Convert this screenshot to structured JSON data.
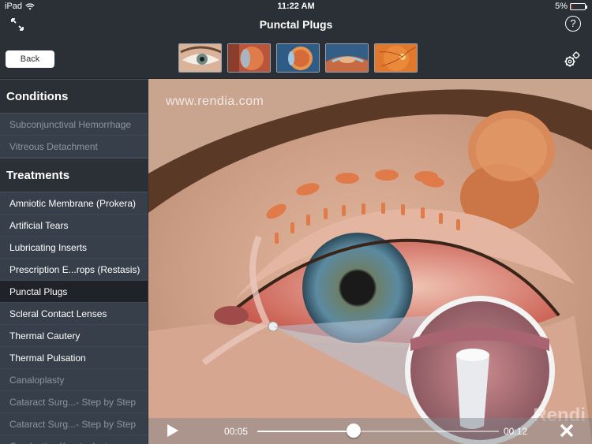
{
  "status": {
    "device": "iPad",
    "time": "11:22 AM",
    "battery": "5%",
    "battery_level": 0.05
  },
  "header": {
    "title": "Punctal Plugs"
  },
  "toolbar": {
    "back_label": "Back",
    "thumbnails": [
      "eye-front",
      "eye-cross-section-1",
      "eye-cross-section-2",
      "eye-cross-section-3",
      "retina"
    ]
  },
  "sidebar": {
    "conditions_header": "Conditions",
    "conditions": [
      {
        "label": "Subconjunctival Hemorrhage",
        "dim": true
      },
      {
        "label": "Vitreous Detachment",
        "dim": true
      }
    ],
    "treatments_header": "Treatments",
    "treatments": [
      {
        "label": "Amniotic Membrane (Prokera)"
      },
      {
        "label": "Artificial Tears"
      },
      {
        "label": "Lubricating Inserts"
      },
      {
        "label": "Prescription E...rops (Restasis)"
      },
      {
        "label": "Punctal Plugs",
        "active": true
      },
      {
        "label": "Scleral Contact Lenses"
      },
      {
        "label": "Thermal Cautery"
      },
      {
        "label": "Thermal Pulsation"
      },
      {
        "label": "Canaloplasty",
        "dim": true
      },
      {
        "label": "Cataract Surg...- Step by Step",
        "dim": true
      },
      {
        "label": "Cataract Surg...- Step by Step",
        "dim": true
      },
      {
        "label": "Conductive Keratoplasty",
        "dim": true
      }
    ]
  },
  "video": {
    "watermark": "www.rendia.com",
    "watermark_brand": "Rendi",
    "current_time": "00:05",
    "duration": "00:12",
    "progress": 0.4
  },
  "colors": {
    "bg": "#2b3036",
    "sidebar": "#37404a",
    "active_item": "#1f2329"
  }
}
